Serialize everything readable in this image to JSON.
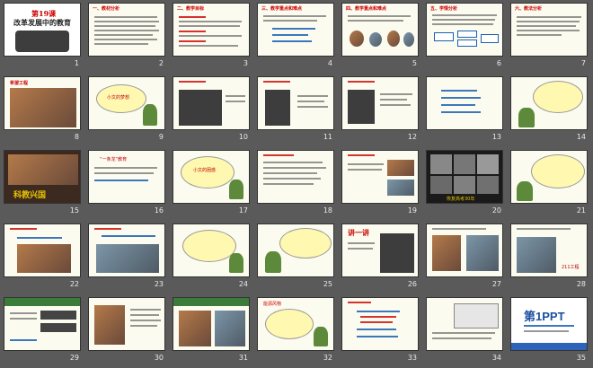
{
  "slides": [
    {
      "n": "1",
      "heading": "第19课",
      "subheading": "改革发展中的教育"
    },
    {
      "n": "2",
      "heading": "一、教材分析"
    },
    {
      "n": "3",
      "heading": "二、教学目标"
    },
    {
      "n": "4",
      "heading": "三、教学重点和难点"
    },
    {
      "n": "5",
      "heading": "四、教学重点和难点"
    },
    {
      "n": "6",
      "heading": "五、学情分析"
    },
    {
      "n": "7",
      "heading": "六、教法分析"
    },
    {
      "n": "8",
      "heading": "希望工程"
    },
    {
      "n": "9",
      "heading": "小文的梦想"
    },
    {
      "n": "10",
      "heading": ""
    },
    {
      "n": "11",
      "heading": ""
    },
    {
      "n": "12",
      "heading": ""
    },
    {
      "n": "13",
      "heading": ""
    },
    {
      "n": "14",
      "heading": ""
    },
    {
      "n": "15",
      "heading": "科教兴国"
    },
    {
      "n": "16",
      "heading": "“一条龙”教育"
    },
    {
      "n": "17",
      "heading": "小文的困惑"
    },
    {
      "n": "18",
      "heading": ""
    },
    {
      "n": "19",
      "heading": ""
    },
    {
      "n": "20",
      "heading": "恢复高考30年"
    },
    {
      "n": "21",
      "heading": ""
    },
    {
      "n": "22",
      "heading": ""
    },
    {
      "n": "23",
      "heading": ""
    },
    {
      "n": "24",
      "heading": ""
    },
    {
      "n": "25",
      "heading": ""
    },
    {
      "n": "26",
      "heading": "讲一讲"
    },
    {
      "n": "27",
      "heading": ""
    },
    {
      "n": "28",
      "heading": "211工程"
    },
    {
      "n": "29",
      "heading": ""
    },
    {
      "n": "30",
      "heading": ""
    },
    {
      "n": "31",
      "heading": ""
    },
    {
      "n": "32",
      "heading": "能源风物"
    },
    {
      "n": "33",
      "heading": ""
    },
    {
      "n": "34",
      "heading": ""
    },
    {
      "n": "35",
      "heading": "第1PPT"
    }
  ]
}
